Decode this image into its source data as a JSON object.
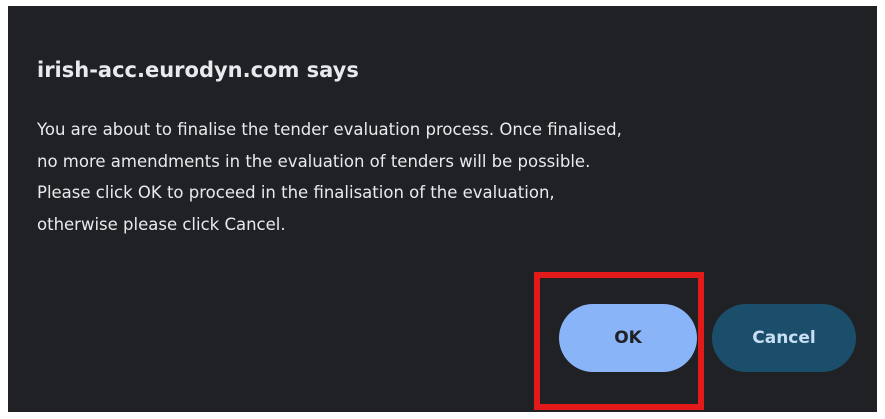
{
  "dialog": {
    "title": "irish-acc.eurodyn.com says",
    "message_lines": [
      "You are about to finalise the tender evaluation process. Once finalised,",
      "no more amendments in the evaluation of tenders will be possible.",
      "Please click OK to proceed in the finalisation of the evaluation,",
      "otherwise please click Cancel."
    ],
    "ok_label": "OK",
    "cancel_label": "Cancel"
  },
  "colors": {
    "dialog_background": "#202124",
    "text": "#e8eaed",
    "ok_button": "#8ab4f8",
    "cancel_button": "#1a4e6b",
    "highlight_border": "#e21a1a"
  }
}
